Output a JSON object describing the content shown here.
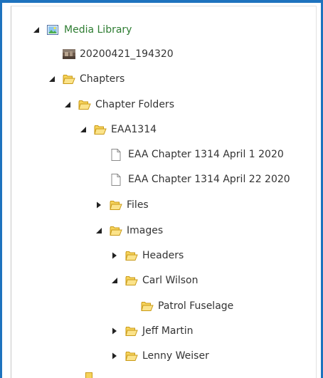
{
  "tree": {
    "media_library": {
      "label": "Media Library",
      "icon": "media-library-icon",
      "color": "#2e7d32"
    },
    "photo_item": {
      "label": "20200421_194320",
      "icon": "photo-thumbnail-icon"
    },
    "chapters": {
      "label": "Chapters",
      "icon": "folder-icon"
    },
    "chapter_folders": {
      "label": "Chapter Folders",
      "icon": "folder-icon"
    },
    "eaa1314": {
      "label": "EAA1314",
      "icon": "folder-icon"
    },
    "doc1": {
      "label": "EAA Chapter 1314 April 1 2020",
      "icon": "document-icon"
    },
    "doc2": {
      "label": "EAA Chapter 1314 April 22 2020",
      "icon": "document-icon"
    },
    "files": {
      "label": "Files",
      "icon": "folder-icon"
    },
    "images": {
      "label": "Images",
      "icon": "folder-icon"
    },
    "headers": {
      "label": "Headers",
      "icon": "folder-icon"
    },
    "carl_wilson": {
      "label": "Carl Wilson",
      "icon": "folder-icon"
    },
    "patrol_fuselage": {
      "label": "Patrol Fuselage",
      "icon": "folder-icon"
    },
    "jeff_martin": {
      "label": "Jeff Martin",
      "icon": "folder-icon"
    },
    "lenny_weiser": {
      "label": "Lenny Weiser",
      "icon": "folder-icon"
    }
  },
  "colors": {
    "frame_border": "#1e73be",
    "folder_fill": "#f6d35b",
    "folder_stroke": "#c99a17"
  }
}
